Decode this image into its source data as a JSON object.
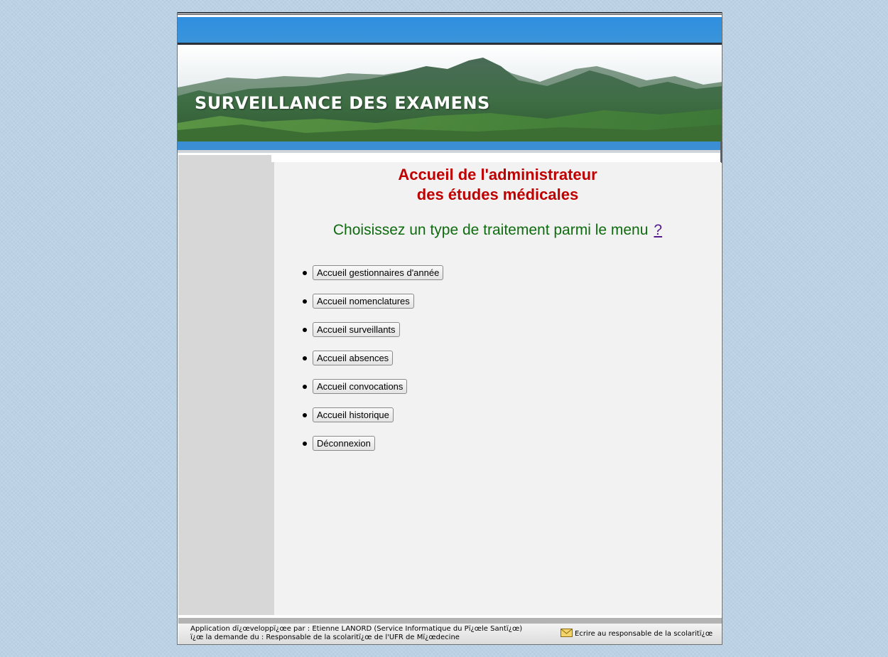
{
  "header": {
    "banner_title": "SURVEILLANCE DES EXAMENS"
  },
  "main": {
    "title_line1": "Accueil de l'administrateur",
    "title_line2": "des études médicales",
    "subtitle": "Choisissez un type de traitement parmi le menu",
    "help_link": "?",
    "menu": [
      {
        "label": "Accueil gestionnaires d'année"
      },
      {
        "label": "Accueil nomenclatures"
      },
      {
        "label": "Accueil surveillants"
      },
      {
        "label": "Accueil absences"
      },
      {
        "label": "Accueil convocations"
      },
      {
        "label": "Accueil historique"
      },
      {
        "label": "Déconnexion"
      }
    ]
  },
  "footer": {
    "line1": "Application dï¿œveloppï¿œe par : Etienne LANORD (Service Informatique du Pï¿œle Santï¿œ)",
    "line2": "ï¿œ la demande du : Responsable de la scolaritï¿œ de l'UFR de Mï¿œdecine",
    "contact_link": "Ecrire au responsable de la scolaritï¿œ"
  },
  "colors": {
    "background": "#b5cde2",
    "header_blue": "#3a94da",
    "title_red": "#c00000",
    "subtitle_green": "#0f6b0f",
    "sidebar_gray": "#d7d7d7",
    "content_gray": "#f2f2f2"
  },
  "icons": {
    "contact": "envelope-icon"
  }
}
